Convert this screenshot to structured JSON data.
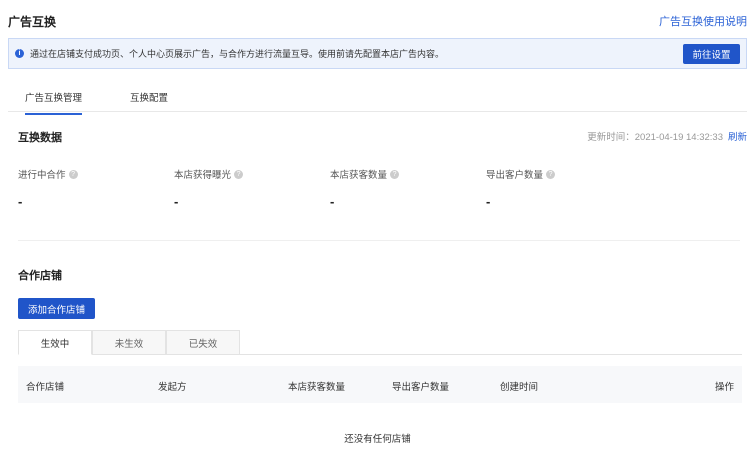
{
  "header": {
    "title": "广告互换",
    "help_link": "广告互换使用说明"
  },
  "notice": {
    "text": "通过在店铺支付成功页、个人中心页展示广告，与合作方进行流量互导。使用前请先配置本店广告内容。",
    "button": "前往设置"
  },
  "tabs": [
    {
      "label": "广告互换管理",
      "active": true
    },
    {
      "label": "互换配置",
      "active": false
    }
  ],
  "exchange_data": {
    "title": "互换数据",
    "update_label": "更新时间：2021-04-19 14:32:33",
    "refresh": "刷新",
    "stats": [
      {
        "label": "进行中合作",
        "value": "-"
      },
      {
        "label": "本店获得曝光",
        "value": "-"
      },
      {
        "label": "本店获客数量",
        "value": "-"
      },
      {
        "label": "导出客户数量",
        "value": "-"
      }
    ]
  },
  "partners": {
    "title": "合作店铺",
    "add_button": "添加合作店铺",
    "tabs": [
      {
        "label": "生效中",
        "active": true
      },
      {
        "label": "未生效",
        "active": false
      },
      {
        "label": "已失效",
        "active": false
      }
    ],
    "columns": [
      "合作店铺",
      "发起方",
      "本店获客数量",
      "导出客户数量",
      "创建时间",
      "操作"
    ],
    "empty_text": "还没有任何店铺"
  },
  "colors": {
    "accent": "#2055c9",
    "notice_bg": "#eef3fc"
  }
}
